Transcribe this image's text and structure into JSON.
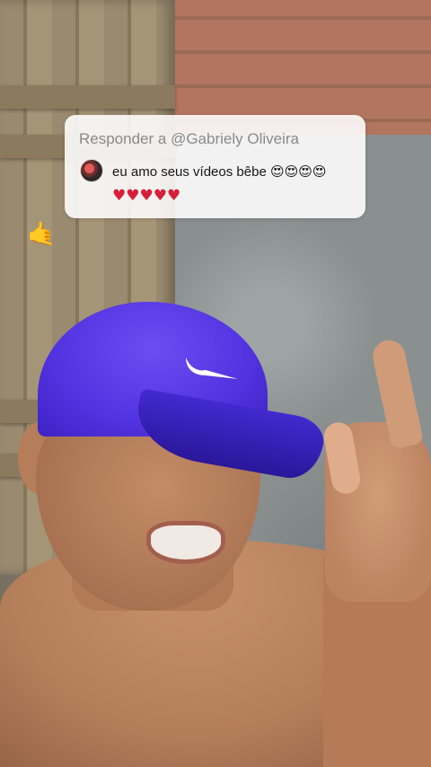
{
  "reply": {
    "header": "Responder a @Gabriely Oliveira",
    "comment_line1": "eu amo seus vídeos bêbe 😍😍😍😍",
    "comment_line2": "♥♥♥♥♥"
  },
  "overlay": {
    "hand_emoji": "🤙"
  },
  "icons": {
    "commenter_avatar": "avatar",
    "brand": "nike-swoosh"
  },
  "colors": {
    "cap": "#5233e0",
    "heart": "#d61f3a",
    "header_text": "#8a8a8a"
  }
}
